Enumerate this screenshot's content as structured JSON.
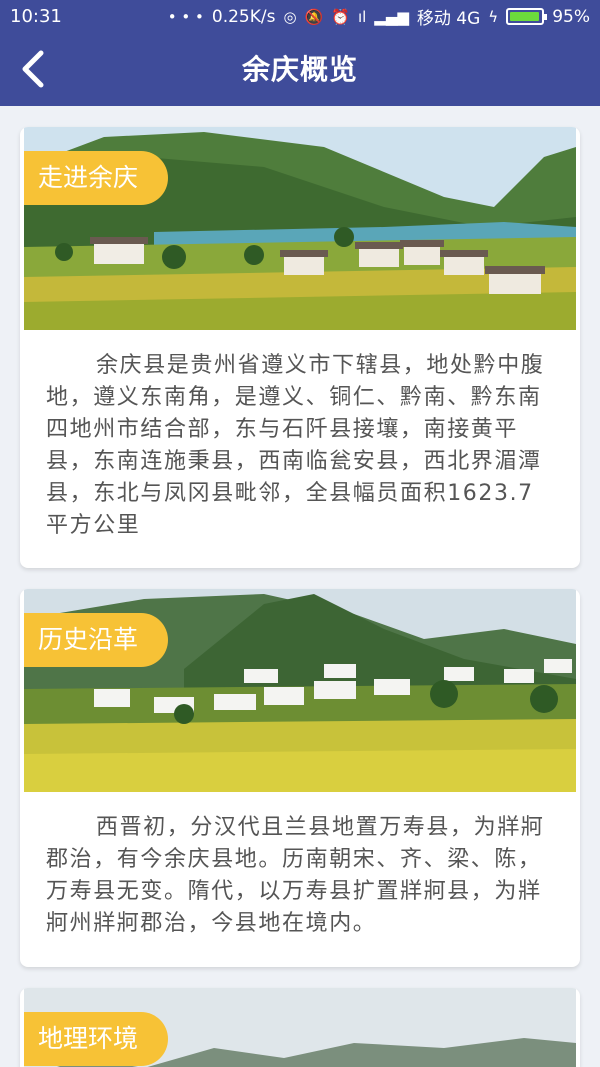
{
  "status_bar": {
    "time": "10:31",
    "dots": "• • •",
    "speed": "0.25K/s",
    "carrier": "移动 4G",
    "battery": "95%",
    "battery_level": 0.95
  },
  "header": {
    "title": "余庆概览",
    "back_icon": "chevron-left-icon"
  },
  "sections": [
    {
      "tag": "走进余庆",
      "text": "余庆县是贵州省遵义市下辖县，地处黔中腹地，遵义东南角，是遵义、铜仁、黔南、黔东南四地州市结合部，东与石阡县接壤，南接黄平县，东南连施秉县，西南临瓮安县，西北界湄潭县，东北与凤冈县毗邻，全县幅员面积1623.7平方公里"
    },
    {
      "tag": "历史沿革",
      "text": "西晋初，分汉代且兰县地置万寿县，为牂牁郡治，有今余庆县地。历南朝宋、齐、梁、陈，万寿县无变。隋代，以万寿县扩置牂牁县，为牂牁州牂牁郡治，今县地在境内。"
    },
    {
      "tag": "地理环境",
      "text": ""
    }
  ],
  "colors": {
    "primary": "#3f4c9a",
    "tag": "#f7c236",
    "background": "#eef1f6"
  }
}
